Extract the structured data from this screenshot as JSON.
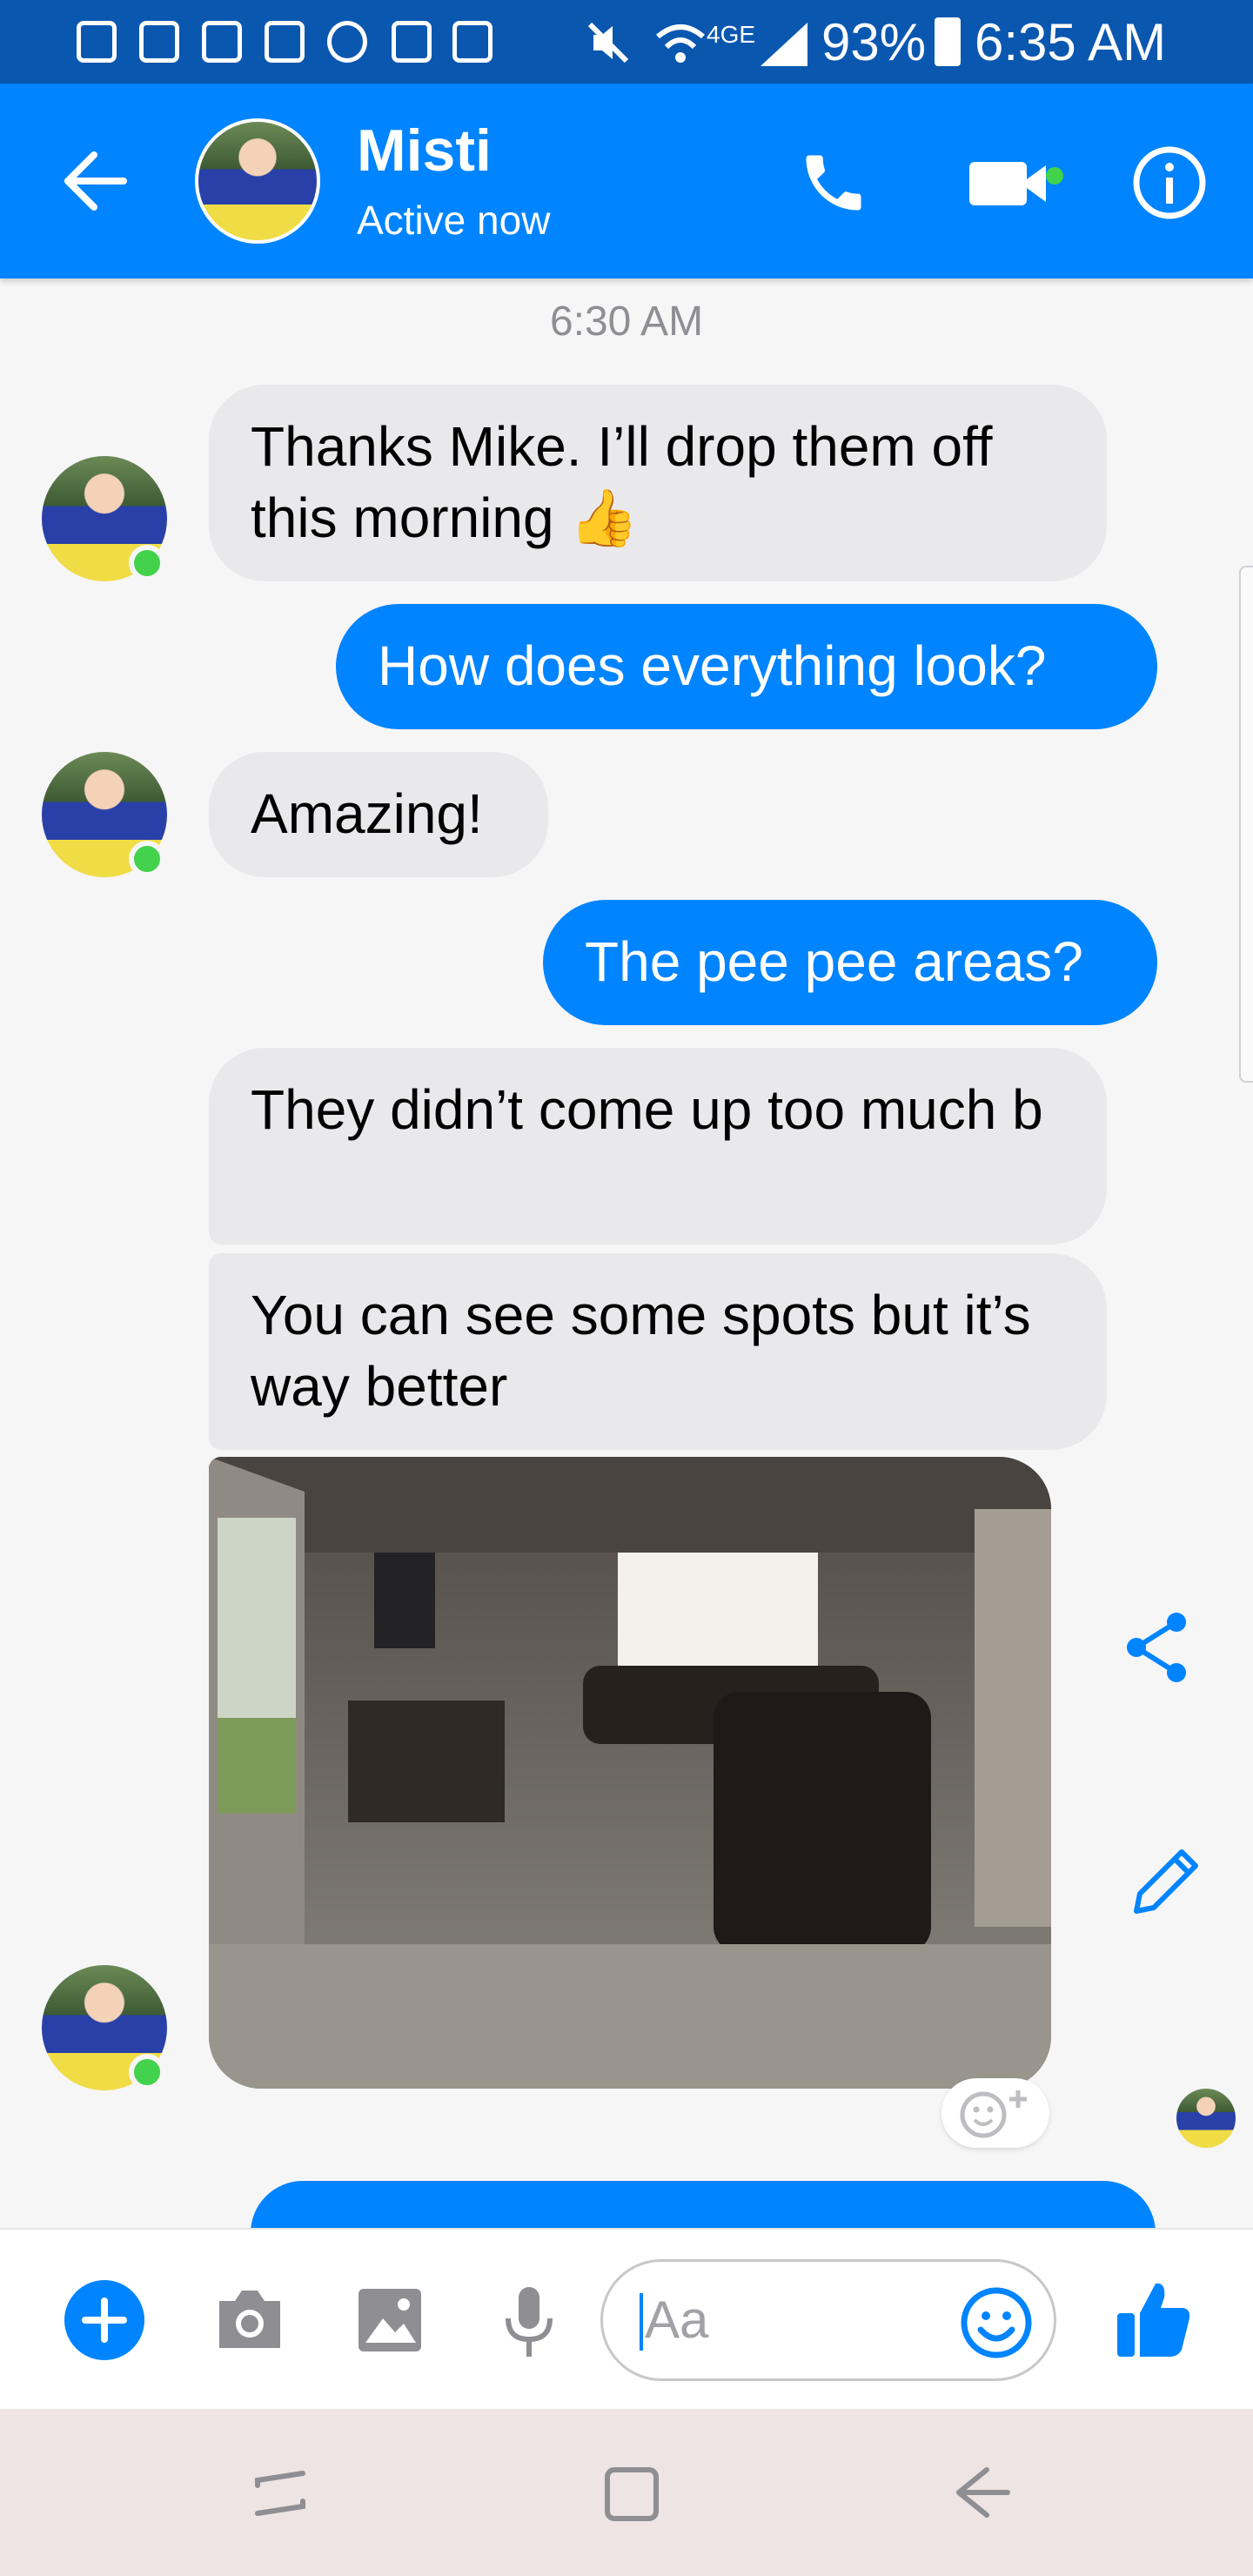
{
  "status_bar": {
    "network": "4GE",
    "battery": "93%",
    "time": "6:35 AM"
  },
  "header": {
    "contact_name": "Misti",
    "status": "Active now",
    "icons": [
      "back-arrow-icon",
      "phone-icon",
      "video-camera-icon",
      "info-icon"
    ]
  },
  "conversation": {
    "timestamp": "6:30 AM",
    "messages": [
      {
        "from": "Misti",
        "text": "Thanks Mike. I’ll drop them off this morning 👍"
      },
      {
        "from": "me",
        "text": "How does everything look?"
      },
      {
        "from": "Misti",
        "text": "Amazing!"
      },
      {
        "from": "me",
        "text": "The pee pee areas?"
      },
      {
        "from": "Misti",
        "text": "They didn’t come up too much b"
      },
      {
        "from": "Misti",
        "text": "You can see some spots but it’s way better"
      },
      {
        "from": "Misti",
        "type": "photo",
        "description_icon": "living-room-photo"
      }
    ],
    "photo_action_icons": [
      "share-icon",
      "edit-pencil-icon",
      "add-reaction-icon"
    ]
  },
  "composer": {
    "placeholder": "Aa",
    "icons": [
      "plus-icon",
      "camera-icon",
      "gallery-icon",
      "microphone-icon",
      "emoji-icon",
      "thumbs-up-icon"
    ]
  },
  "nav_bar": {
    "icons": [
      "recent-apps-icon",
      "home-icon",
      "back-icon"
    ]
  },
  "colors": {
    "status_bar": "#0a57b0",
    "header": "#0084ff",
    "outgoing_bubble": "#0084ff",
    "incoming_bubble": "#e9e9eb",
    "presence": "#42d24b"
  }
}
